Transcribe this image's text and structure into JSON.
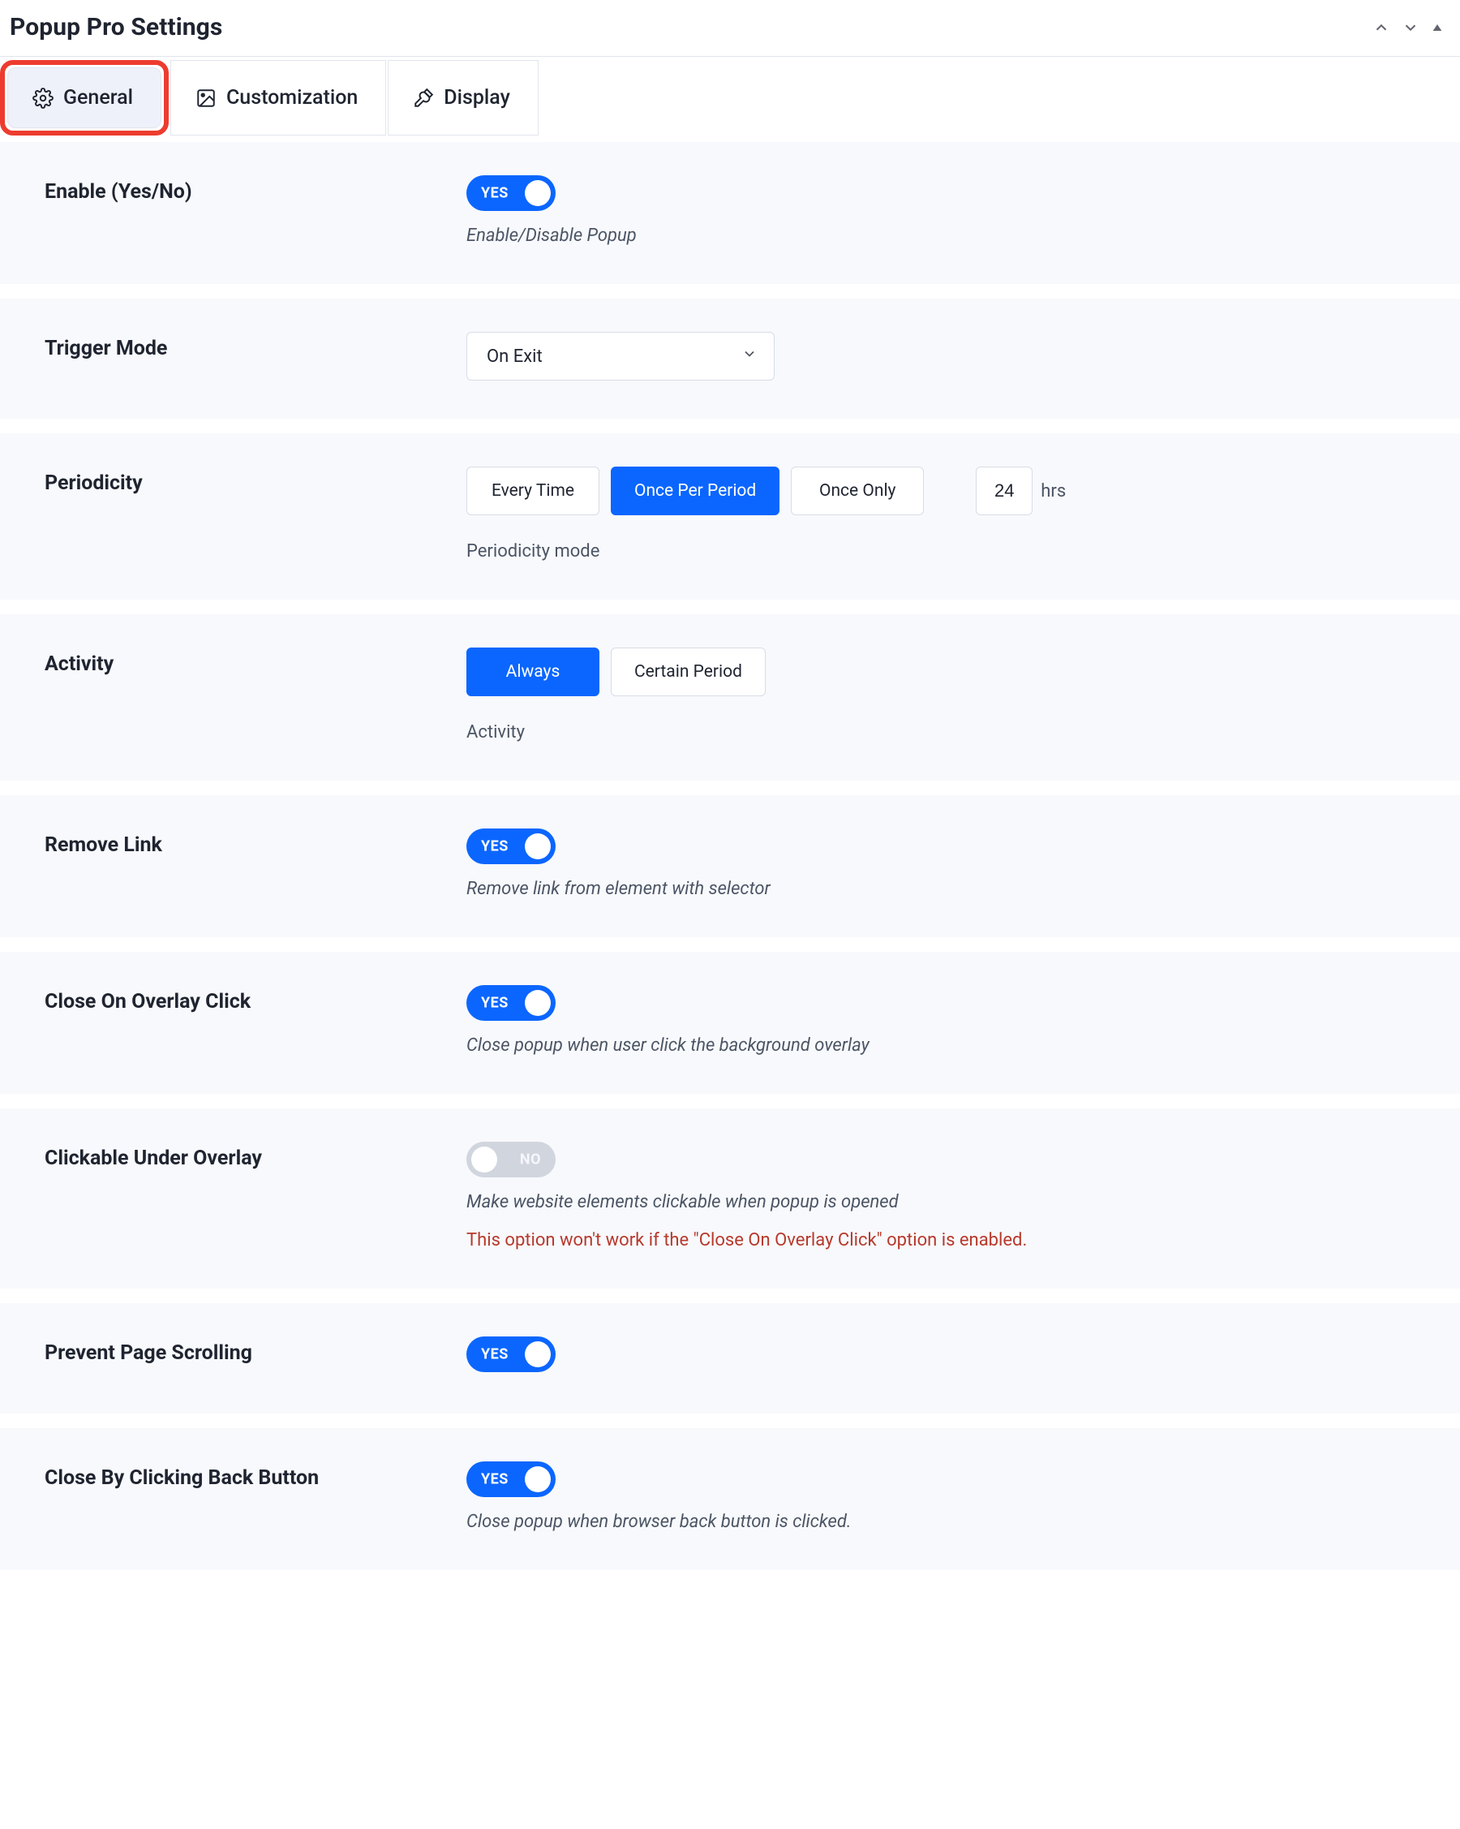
{
  "header": {
    "title": "Popup Pro Settings"
  },
  "tabs": [
    {
      "id": "general",
      "label": "General",
      "active": true,
      "highlighted": true,
      "icon": "gear"
    },
    {
      "id": "customization",
      "label": "Customization",
      "active": false,
      "highlighted": false,
      "icon": "image"
    },
    {
      "id": "display",
      "label": "Display",
      "active": false,
      "highlighted": false,
      "icon": "tools"
    }
  ],
  "fields": {
    "enable": {
      "label": "Enable (Yes/No)",
      "toggle": "YES",
      "on": true,
      "hint": "Enable/Disable Popup"
    },
    "trigger_mode": {
      "label": "Trigger Mode",
      "value": "On Exit"
    },
    "periodicity": {
      "label": "Periodicity",
      "options": [
        "Every Time",
        "Once Per Period",
        "Once Only"
      ],
      "active_index": 1,
      "period_value": "24",
      "period_unit": "hrs",
      "hint": "Periodicity mode"
    },
    "activity": {
      "label": "Activity",
      "options": [
        "Always",
        "Certain Period"
      ],
      "active_index": 0,
      "hint": "Activity"
    },
    "remove_link": {
      "label": "Remove Link",
      "toggle": "YES",
      "on": true,
      "hint": "Remove link from element with selector"
    },
    "close_overlay": {
      "label": "Close On Overlay Click",
      "toggle": "YES",
      "on": true,
      "hint": "Close popup when user click the background overlay"
    },
    "clickable_under": {
      "label": "Clickable Under Overlay",
      "toggle": "NO",
      "on": false,
      "hint": "Make website elements clickable when popup is opened",
      "warning": "This option won't work if the \"Close On Overlay Click\" option is enabled."
    },
    "prevent_scroll": {
      "label": "Prevent Page Scrolling",
      "toggle": "YES",
      "on": true
    },
    "close_back": {
      "label": "Close By Clicking Back Button",
      "toggle": "YES",
      "on": true,
      "hint": "Close popup when browser back button is clicked."
    }
  }
}
